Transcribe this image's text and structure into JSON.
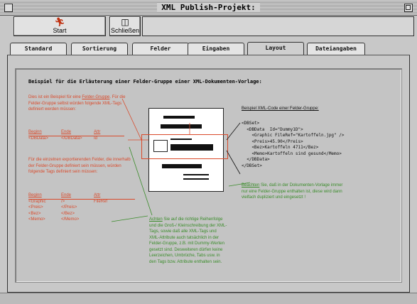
{
  "window": {
    "title": "XML Publish-Projekt:"
  },
  "toolbar": {
    "start_label": "Start",
    "close_label": "Schließen"
  },
  "tabs": [
    {
      "label": "Standard",
      "active": false
    },
    {
      "label": "Sortierung",
      "active": false
    },
    {
      "label": "Felder",
      "active": false
    },
    {
      "label": "Eingaben",
      "active": false
    },
    {
      "label": "Layout",
      "active": true
    },
    {
      "label": "Dateiangaben",
      "active": false
    }
  ],
  "layout_panel": {
    "heading": "Beispiel für die Erläuterung einer Felder-Gruppe einer XML-Dokumenten-Vorlage:",
    "intro": {
      "prefix": "Dies ist ein Beispiel für eine ",
      "link": "Felder-Gruppe",
      "suffix": ". Für die Felder-Gruppe selbst würden folgende XML-Tags definiert werden müssen:"
    },
    "table1": {
      "headers": [
        "Beginn",
        "Ende",
        "Attr"
      ],
      "rows": [
        [
          "<DBData>",
          "</DBData>",
          "Id"
        ]
      ]
    },
    "middle_text": "Für die einzelnen exportierenden Felder, die innerhalb der Felder-Gruppe definiert sein müssen, würden folgende Tags definiert sein müssen:",
    "table2": {
      "headers": [
        "Beginn",
        "Ende",
        "Attr"
      ],
      "rows": [
        [
          "<Graphic",
          "/>",
          "FileRef"
        ],
        [
          "<Preis>",
          "</Preis>",
          ""
        ],
        [
          "<Bez>",
          "</Bez>",
          ""
        ],
        [
          "<Memo>",
          "</Memo>",
          ""
        ]
      ]
    },
    "note": {
      "link": "Achten",
      "text": " Sie auf die richtige Reihenfolge und die Groß-/ Kleinschreibung der XML-Tags, sowie daß alle XML-Tags und XML-Attribute auch tatsächlich in der Felder-Gruppe, z.B. mit Dummy-Werten gesetzt sind. Desweiteren dürfen keine Leerzeichen, Umbrüche, Tabs usw. in den Tags bzw. Attribute enthalten sein."
    },
    "code_title": "Beispiel XML-Code einer Felder-Gruppe:",
    "code_lines": [
      "<DBSet>",
      "  <DBData  Id=\"Dummy1D\">",
      "    <Graphic FileRef=\"Kartoffeln.jpg\" />",
      "    <Preis>45.90</Preis>",
      "    <Bez>Kartoffeln 4711</Bez>",
      "    <Memo>Kartoffeln sind gesund</Memo>",
      "  </DBData>",
      "</DBSet>"
    ],
    "remark": {
      "link": "Beachten",
      "text": " Sie, daß in der Dokumenten-Vorlage immer nur eine Felder-Gruppe enthalten ist, diese wird dann vielfach dupliziert und eingesetzt !"
    }
  },
  "colors": {
    "annotation_red": "#d94a2b",
    "annotation_green": "#3a8c2a",
    "desktop_blue": "#2a6fb0"
  },
  "icons": {
    "start": "running-person-icon",
    "close": "door-exit-icon"
  }
}
